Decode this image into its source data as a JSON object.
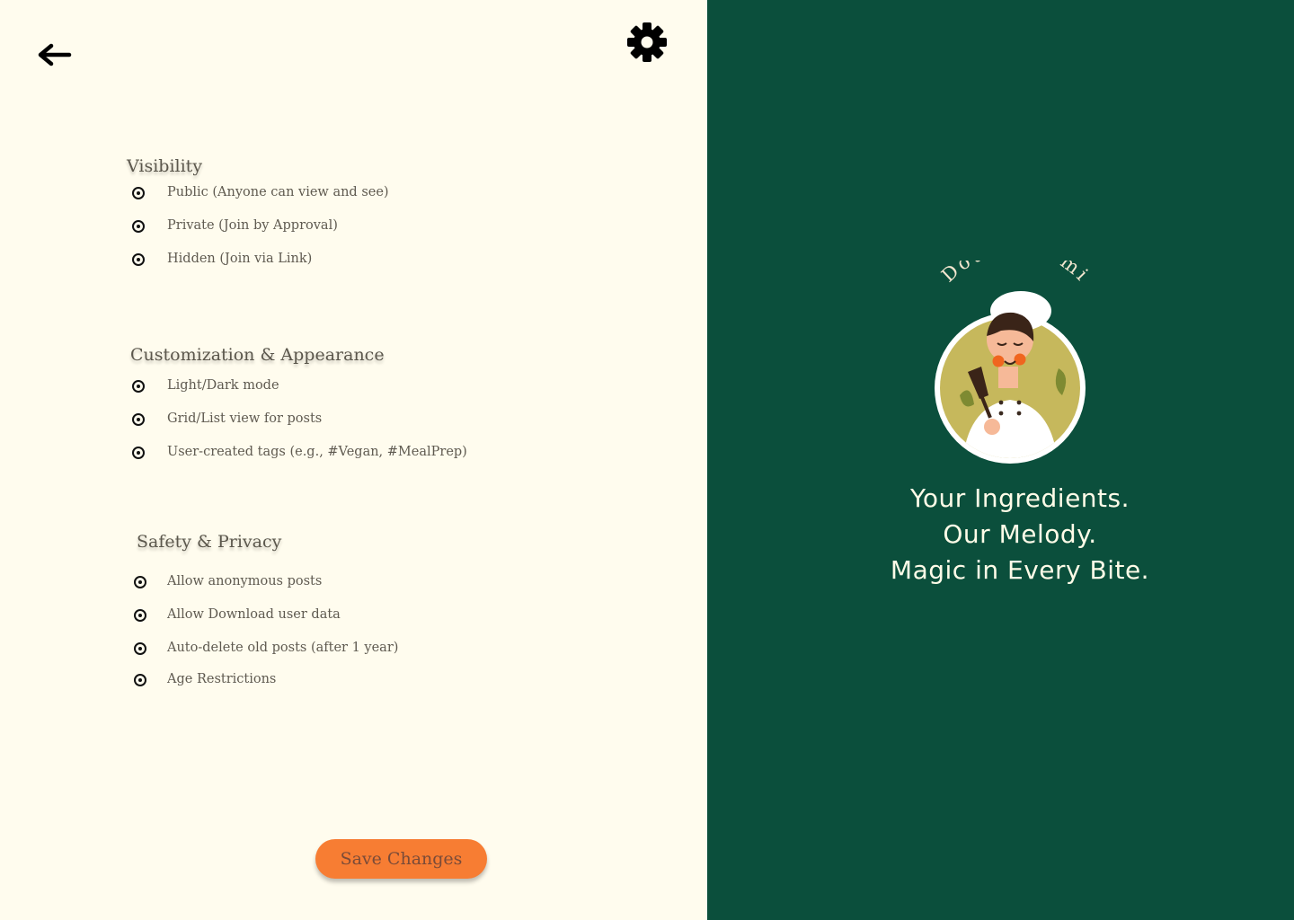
{
  "header": {
    "back_icon": "arrow-left-icon",
    "settings_icon": "gear-icon"
  },
  "sections": [
    {
      "title": "Visibility",
      "options": [
        {
          "label": "Public (Anyone can view and see)"
        },
        {
          "label": "Private (Join by Approval)"
        },
        {
          "label": "Hidden (Join via Link)"
        }
      ]
    },
    {
      "title": "Customization & Appearance",
      "options": [
        {
          "label": "Light/Dark mode"
        },
        {
          "label": "Grid/List view for posts"
        },
        {
          "label": "User-created tags (e.g., #Vegan, #MealPrep)"
        }
      ]
    },
    {
      "title": "Safety & Privacy",
      "options": [
        {
          "label": "Allow anonymous posts"
        },
        {
          "label": "Allow Download user data"
        },
        {
          "label": "Auto-delete old posts (after 1 year)"
        },
        {
          "label": "Age Restrictions"
        }
      ]
    }
  ],
  "save_button": {
    "label": "Save Changes"
  },
  "brand": {
    "logo_text": "Dough-re-mi",
    "tagline": [
      "Your Ingredients.",
      "Our Melody.",
      "Magic in Every Bite."
    ]
  },
  "colors": {
    "left_bg": "#fffcee",
    "right_bg": "#0b4f3c",
    "accent": "#f77d33",
    "logo_circle": "#c6b85c"
  }
}
